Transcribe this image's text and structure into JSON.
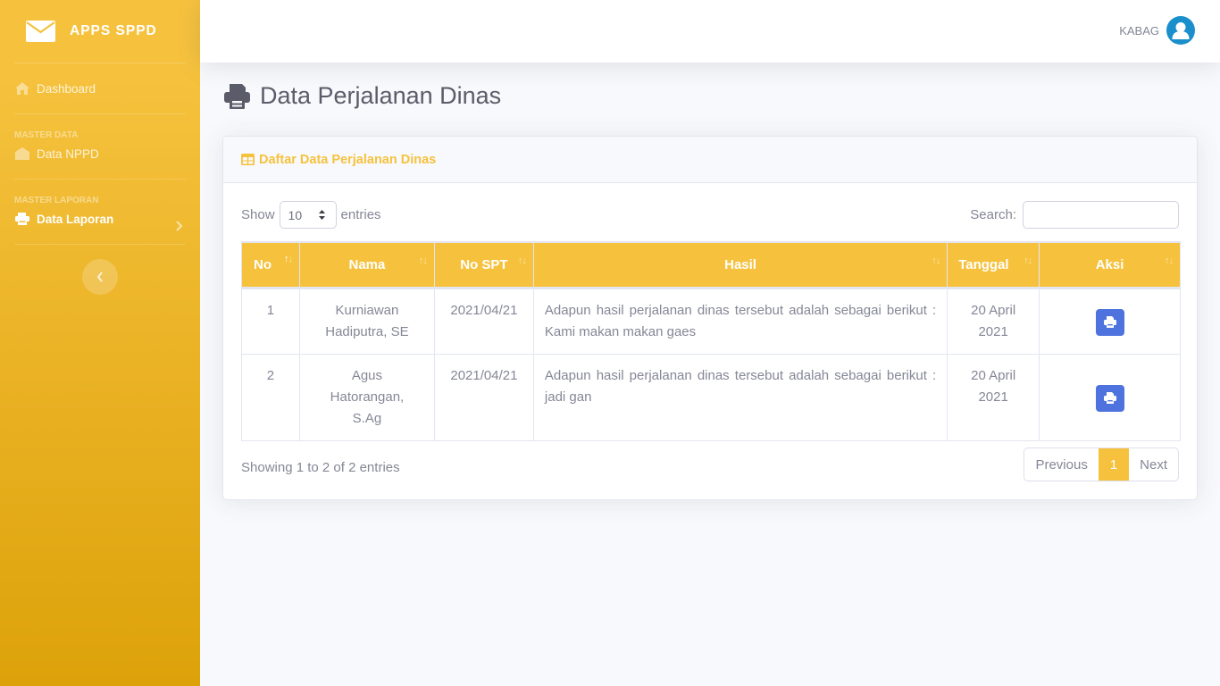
{
  "brand": {
    "title": "APPS SPPD",
    "icon": "envelope-icon"
  },
  "sidebar": {
    "items": [
      {
        "label": "Dashboard",
        "icon": "home-icon",
        "active": false
      },
      {
        "heading": "MASTER DATA"
      },
      {
        "label": "Data NPPD",
        "icon": "envelope-open-icon",
        "active": false
      },
      {
        "heading": "MASTER LAPORAN"
      },
      {
        "label": "Data Laporan",
        "icon": "print-icon",
        "active": true
      }
    ],
    "toggle_icon": "chevron-left-icon"
  },
  "topbar": {
    "user_name": "KABAG",
    "avatar_icon": "user-icon"
  },
  "page": {
    "title": "Data Perjalanan Dinas",
    "title_icon": "print-icon"
  },
  "card": {
    "title": "Daftar Data Perjalanan Dinas",
    "title_icon": "table-icon",
    "length": {
      "prefix": "Show",
      "value": "10",
      "suffix": "entries"
    },
    "search": {
      "label": "Search:",
      "value": "",
      "placeholder": ""
    },
    "table": {
      "columns": [
        "No",
        "Nama",
        "No SPT",
        "Hasil",
        "Tanggal",
        "Aksi"
      ],
      "sorted_column": "No",
      "rows": [
        {
          "no": "1",
          "nama": "Kurniawan Hadiputra, SE",
          "no_spt": "2021/04/21",
          "hasil": "Adapun hasil perjalanan dinas tersebut adalah sebagai berikut : Kami makan makan gaes",
          "tanggal": "20 April 2021",
          "aksi_icon": "print-icon"
        },
        {
          "no": "2",
          "nama": "Agus Hatorangan, S.Ag",
          "no_spt": "2021/04/21",
          "hasil": "Adapun hasil perjalanan dinas tersebut adalah sebagai berikut : jadi gan",
          "tanggal": "20 April 2021",
          "aksi_icon": "print-icon"
        }
      ]
    },
    "info": "Showing 1 to 2 of 2 entries",
    "pagination": {
      "previous": "Previous",
      "current": "1",
      "next": "Next"
    }
  },
  "colors": {
    "primary_warning": "#f6c23e",
    "sidebar_bottom": "#dda20a",
    "button_primary": "#4e73df",
    "avatar": "#1a8fcb"
  }
}
